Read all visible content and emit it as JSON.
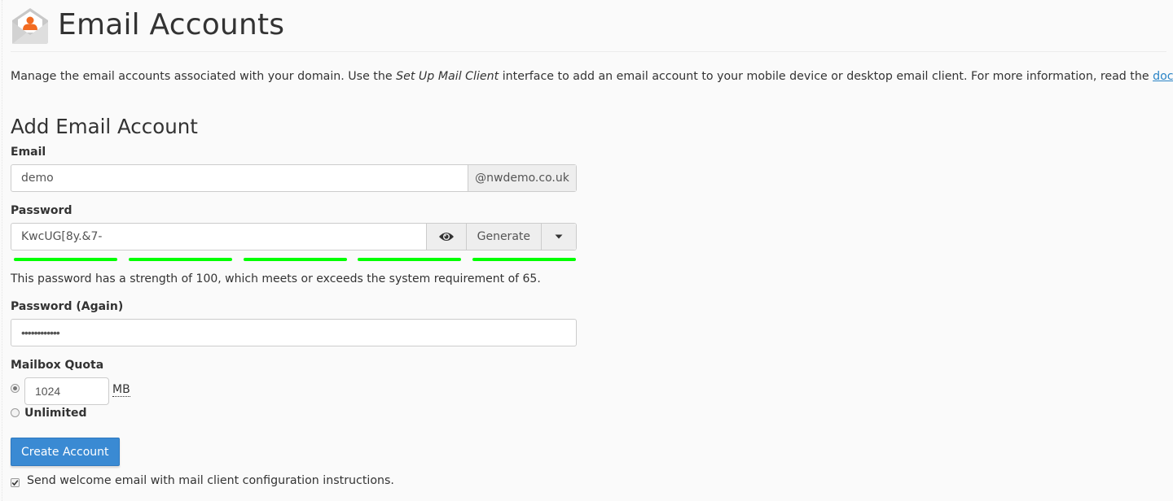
{
  "header": {
    "icon": "email-accounts-icon",
    "title": "Email Accounts"
  },
  "description": {
    "part1": "Manage the email accounts associated with your domain. Use the ",
    "emphasis": "Set Up Mail Client",
    "part2": " interface to add an email account to your mobile device or desktop email client. For more information, read the ",
    "link_text": "documentation",
    "part3": "."
  },
  "form": {
    "section_title": "Add Email Account",
    "email": {
      "label": "Email",
      "value": "demo",
      "domain_suffix": "@nwdemo.co.uk"
    },
    "password": {
      "label": "Password",
      "value": "KwcUG[8y.&7-",
      "show_icon": "eye-icon",
      "generate_label": "Generate",
      "dropdown_icon": "caret-down-icon",
      "strength_segments_filled": 5,
      "strength_segments_total": 5,
      "strength_color": "#00ff00",
      "strength_message": "This password has a strength of 100, which meets or exceeds the system requirement of 65."
    },
    "password_again": {
      "label": "Password (Again)",
      "value": "••••••••••••"
    },
    "quota": {
      "label": "Mailbox Quota",
      "value": "1024",
      "unit": "MB",
      "limited_selected": true,
      "unlimited_label": "Unlimited"
    },
    "submit_label": "Create Account",
    "welcome_email": {
      "checked": true,
      "label": "Send welcome email with mail client configuration instructions."
    }
  },
  "colors": {
    "primary_button": "#3a8ad3",
    "link": "#2a84c6",
    "icon_accent": "#f26b21"
  }
}
